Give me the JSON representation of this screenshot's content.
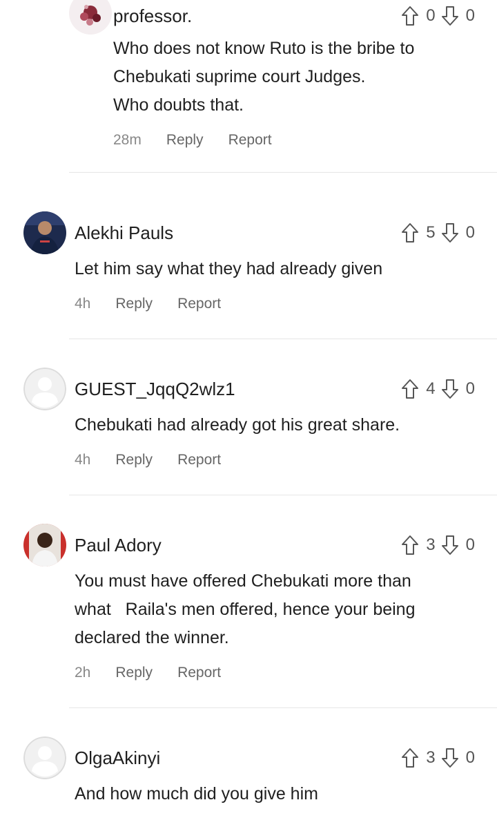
{
  "comments": [
    {
      "username": "professor.",
      "upvotes": "0",
      "downvotes": "0",
      "lines": [
        "Who does not know Ruto is the bribe to",
        "Chebukati suprime court Judges.",
        "Who doubts that."
      ],
      "time": "28m",
      "reply_label": "Reply",
      "report_label": "Report",
      "avatar": "floral-avatar"
    },
    {
      "username": "Alekhi Pauls",
      "upvotes": "5",
      "downvotes": "0",
      "lines": [
        "Let him say what they had already given"
      ],
      "time": "4h",
      "reply_label": "Reply",
      "report_label": "Report",
      "avatar": "photo-avatar"
    },
    {
      "username": "GUEST_JqqQ2wlz1",
      "upvotes": "4",
      "downvotes": "0",
      "lines": [
        "Chebukati had already got his great share."
      ],
      "time": "4h",
      "reply_label": "Reply",
      "report_label": "Report",
      "avatar": "default-avatar"
    },
    {
      "username": "Paul Adory",
      "upvotes": "3",
      "downvotes": "0",
      "lines": [
        "You must have offered Chebukati more than",
        "what   Raila's men offered, hence your being",
        "declared the winner."
      ],
      "time": "2h",
      "reply_label": "Reply",
      "report_label": "Report",
      "avatar": "photo-avatar"
    },
    {
      "username": "OlgaAkinyi",
      "upvotes": "3",
      "downvotes": "0",
      "lines": [
        "And how much did you give him"
      ],
      "time": "",
      "reply_label": "",
      "report_label": "",
      "avatar": "default-avatar"
    }
  ]
}
